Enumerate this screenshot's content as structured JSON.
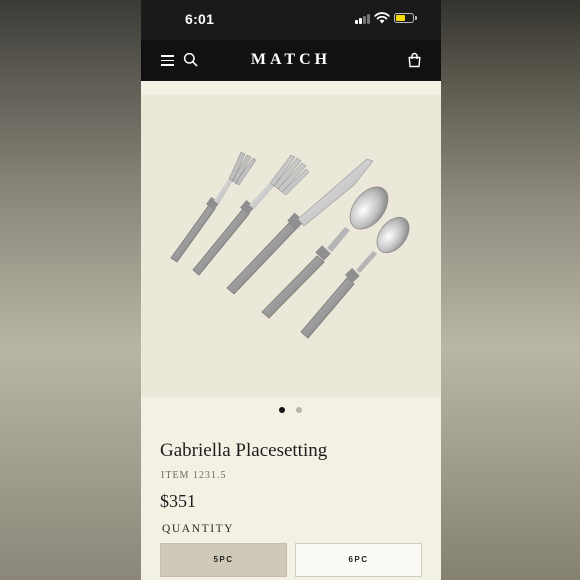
{
  "status_bar": {
    "time": "6:01"
  },
  "header": {
    "brand": "MATCH",
    "icons": [
      "menu-icon",
      "search-icon",
      "shopping-bag-icon"
    ]
  },
  "gallery": {
    "image_subject": "five-piece flatware placesetting",
    "slides": 2,
    "active_slide": 1
  },
  "product": {
    "title": "Gabriella Placesetting",
    "item_number": "ITEM 1231.5",
    "price": "$351",
    "quantity_label": "QUANTITY",
    "options": [
      {
        "label": "5PC",
        "selected": true
      },
      {
        "label": "6PC",
        "selected": false
      }
    ]
  },
  "colors": {
    "header_bg": "#111111",
    "page_bg": "#f3f0e4",
    "selected_option_bg": "#cfcab8"
  }
}
